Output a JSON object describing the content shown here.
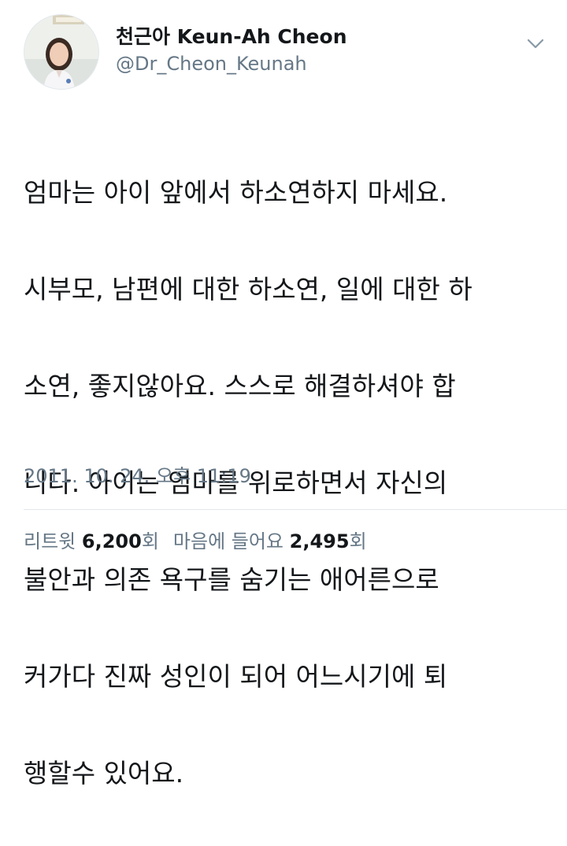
{
  "author": {
    "display_name": "천근아 Keun-Ah Cheon",
    "handle": "@Dr_Cheon_Keunah"
  },
  "tweet": {
    "lines": [
      "엄마는 아이 앞에서 하소연하지 마세요.",
      "시부모, 남편에 대한 하소연, 일에 대한 하",
      "소연, 좋지않아요. 스스로 해결하셔야 합",
      "니다. 아이는 엄마를 위로하면서 자신의",
      "불안과 의존 욕구를 숨기는 애어른으로",
      "커가다 진짜 성인이 되어 어느시기에 퇴",
      "행할수 있어요."
    ],
    "timestamp": "2011. 10. 24. 오후 11:19"
  },
  "stats": {
    "retweets_label": "리트윗",
    "retweets_count": "6,200",
    "retweets_unit": "회",
    "likes_label": "마음에 들어요",
    "likes_count": "2,495",
    "likes_unit": "회"
  },
  "icons": {
    "menu": "chevron-down-icon"
  },
  "colors": {
    "text_primary": "#14171a",
    "text_secondary": "#657786",
    "divider": "#e1e8ed"
  }
}
